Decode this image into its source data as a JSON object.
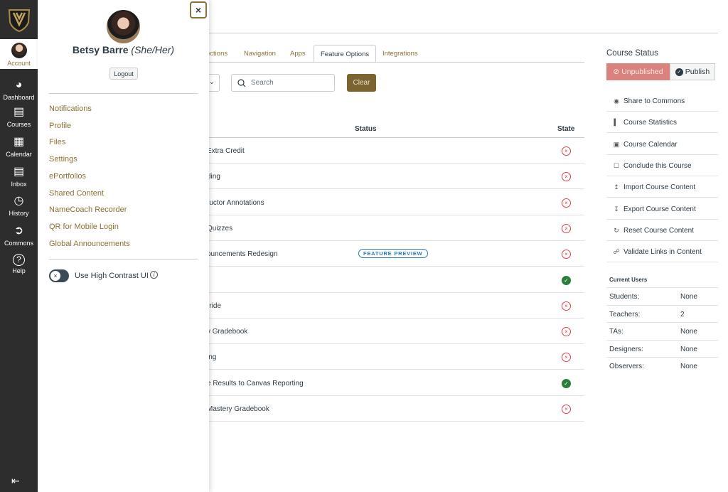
{
  "global_nav": {
    "account": "Account",
    "items": [
      {
        "label": "Dashboard",
        "icon": "dashboard-icon"
      },
      {
        "label": "Courses",
        "icon": "courses-icon"
      },
      {
        "label": "Calendar",
        "icon": "calendar-icon"
      },
      {
        "label": "Inbox",
        "icon": "inbox-icon"
      },
      {
        "label": "History",
        "icon": "history-icon"
      },
      {
        "label": "Commons",
        "icon": "commons-icon"
      },
      {
        "label": "Help",
        "icon": "help-icon"
      }
    ]
  },
  "tray": {
    "name": "Betsy Barre",
    "pronouns": "(She/Her)",
    "logout": "Logout",
    "links": [
      "Notifications",
      "Profile",
      "Files",
      "Settings",
      "ePortfolios",
      "Shared Content",
      "NameCoach Recorder",
      "QR for Mobile Login",
      "Global Announcements"
    ],
    "high_contrast": "Use High Contrast UI"
  },
  "tabs": [
    "ections",
    "Navigation",
    "Apps",
    "Feature Options",
    "Integrations"
  ],
  "search": {
    "placeholder": "Search",
    "clear": "Clear"
  },
  "table": {
    "headers": {
      "status": "Status",
      "state": "State"
    },
    "rows": [
      {
        "name": "Extra Credit",
        "badge": "",
        "state": "off"
      },
      {
        "name": "ding",
        "badge": "",
        "state": "off"
      },
      {
        "name": "ructor Annotations",
        "badge": "",
        "state": "off"
      },
      {
        "name": "Quizzes",
        "badge": "",
        "state": "off"
      },
      {
        "name": "ouncements Redesign",
        "badge": "FEATURE PREVIEW",
        "state": "off"
      },
      {
        "name": "",
        "badge": "",
        "state": "on"
      },
      {
        "name": "rride",
        "badge": "",
        "state": "off"
      },
      {
        "name": "y Gradebook",
        "badge": "",
        "state": "off"
      },
      {
        "name": "ing",
        "badge": "",
        "state": "off"
      },
      {
        "name": "e Results to Canvas Reporting",
        "badge": "",
        "state": "on"
      },
      {
        "name": "Mastery Gradebook",
        "badge": "",
        "state": "off"
      }
    ]
  },
  "sidebar": {
    "course_status": "Course Status",
    "unpublished": "Unpublished",
    "publish": "Publish",
    "actions": [
      {
        "label": "Share to Commons",
        "icon": "eye-icon"
      },
      {
        "label": "Course Statistics",
        "icon": "bar-chart-icon"
      },
      {
        "label": "Course Calendar",
        "icon": "calendar-icon"
      },
      {
        "label": "Conclude this Course",
        "icon": "lock-icon"
      },
      {
        "label": "Import Course Content",
        "icon": "upload-icon"
      },
      {
        "label": "Export Course Content",
        "icon": "download-icon"
      },
      {
        "label": "Reset Course Content",
        "icon": "reset-icon"
      },
      {
        "label": "Validate Links in Content",
        "icon": "link-icon"
      }
    ],
    "current_users": "Current Users",
    "users": [
      {
        "role": "Students:",
        "count": "None"
      },
      {
        "role": "Teachers:",
        "count": "2"
      },
      {
        "role": "TAs:",
        "count": "None"
      },
      {
        "role": "Designers:",
        "count": "None"
      },
      {
        "role": "Observers:",
        "count": "None"
      }
    ]
  },
  "colors": {
    "brand": "#8b7135",
    "clear_button": "#7b6430",
    "nav_bg": "#2d2d2d",
    "unpublished": "#d9827e",
    "enabled": "#2b7d3a",
    "disabled": "#e0404a"
  }
}
